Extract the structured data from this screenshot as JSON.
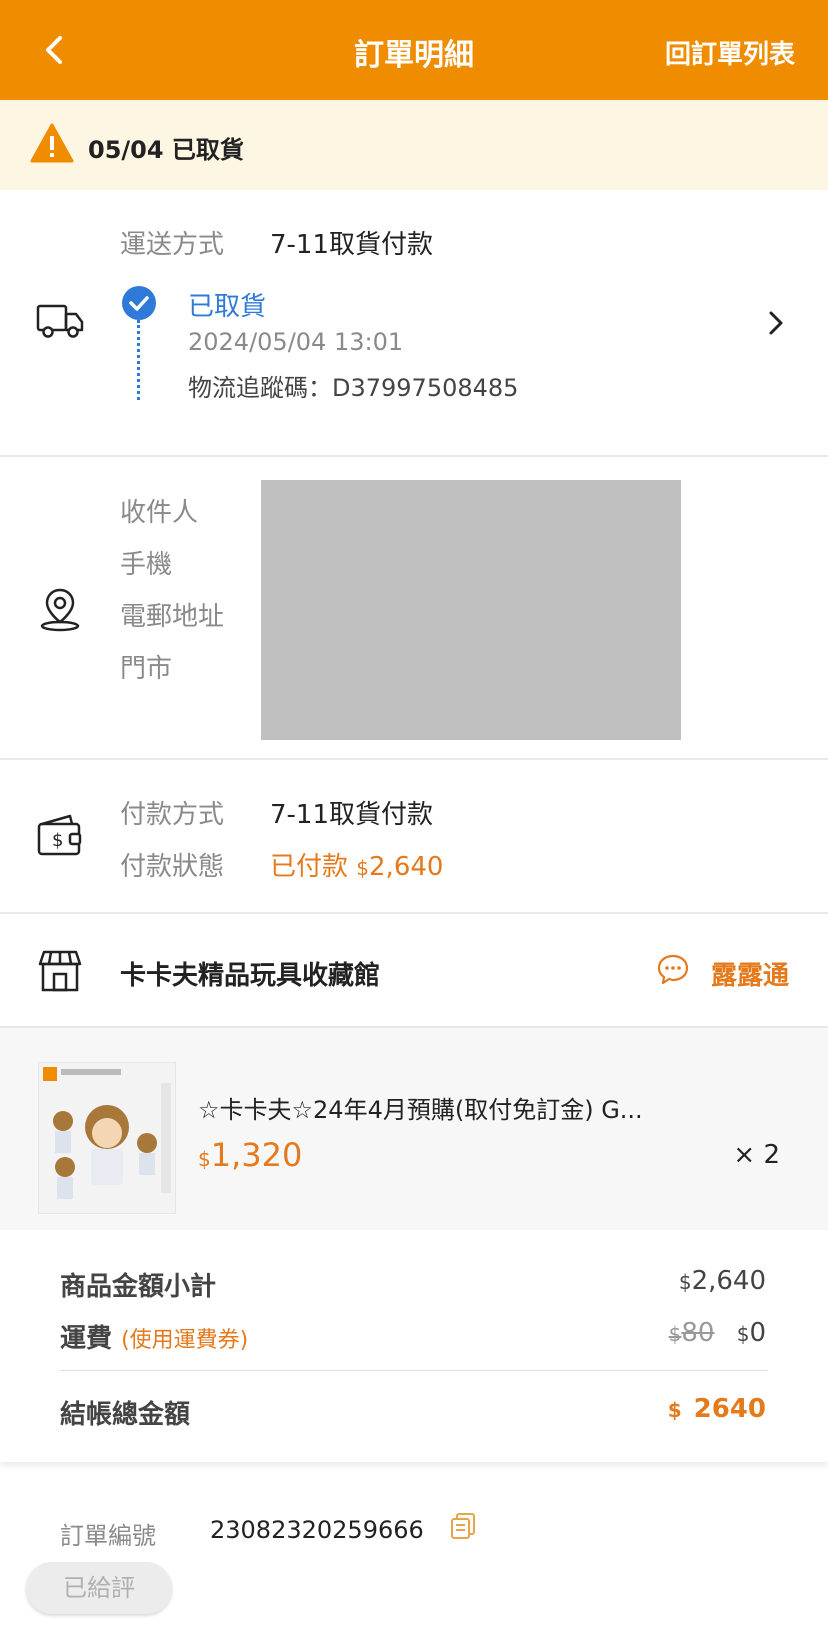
{
  "header": {
    "title": "訂單明細",
    "back_icon": "chevron-left-icon",
    "right_link": "回訂單列表",
    "background": "#f08c00"
  },
  "notice": {
    "icon": "warning-icon",
    "text": "05/04 已取貨"
  },
  "shipping": {
    "label": "運送方式",
    "method": "7-11取貨付款",
    "status": "已取貨",
    "timestamp": "2024/05/04 13:01",
    "tracking": "物流追蹤碼：D37997508485"
  },
  "recipient": {
    "labels": [
      "收件人",
      "手機",
      "電郵地址",
      "門市"
    ]
  },
  "payment": {
    "method_label": "付款方式",
    "method": "7-11取貨付款",
    "status_label": "付款狀態",
    "status": "已付款",
    "currency": "$",
    "amount": "2,640"
  },
  "store": {
    "name": "卡卡夫精品玩具收藏館",
    "chat_label": "露露通"
  },
  "product": {
    "name": "☆卡卡夫☆24年4月預購(取付免訂金) G...",
    "currency": "$",
    "price": "1,320",
    "quantity": "× 2"
  },
  "summary": {
    "subtotal_label": "商品金額小計",
    "subtotal_currency": "$",
    "subtotal": "2,640",
    "shipping_label": "運費",
    "shipping_note": "(使用運費券)",
    "shipping_original_currency": "$",
    "shipping_original": "80",
    "shipping_currency": "$",
    "shipping_final": "0",
    "total_label": "結帳總金額",
    "total_currency": "$",
    "total": "2640"
  },
  "order": {
    "number_label": "訂單編號",
    "number": "23082320259666",
    "rated_button": "已給評"
  },
  "colors": {
    "accent": "#f08c00",
    "price": "#e57a1c",
    "link_blue": "#2f7ad8"
  }
}
